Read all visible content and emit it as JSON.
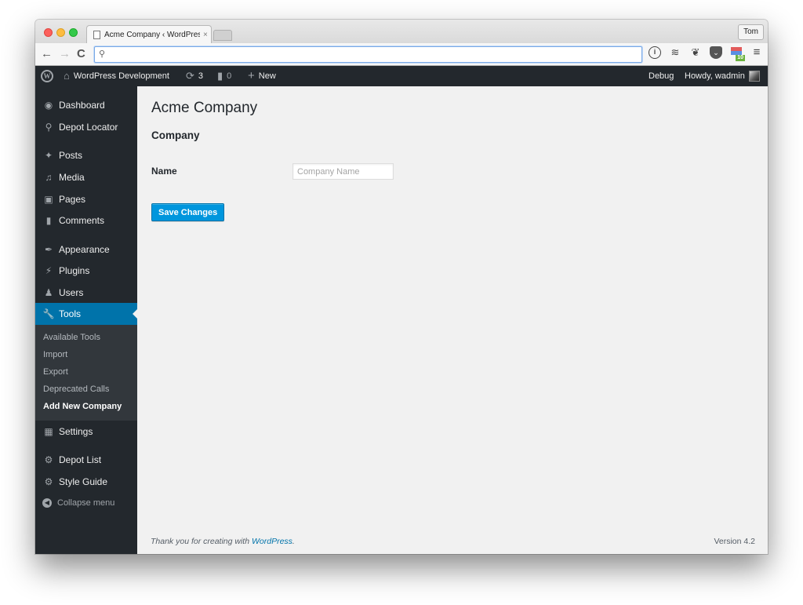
{
  "browser": {
    "tab_title": "Acme Company ‹ WordPress",
    "tab_close": "×",
    "profile_name": "Tom",
    "nav": {
      "back": "←",
      "forward": "→",
      "reload": "C"
    },
    "omnibox_value": "",
    "omnibox_icon": "🔍",
    "extensions": [
      {
        "name": "1password-icon",
        "glyph": "i"
      },
      {
        "name": "buffer-icon",
        "glyph": "≋"
      },
      {
        "name": "evernote-icon",
        "glyph": "❦"
      },
      {
        "name": "pocket-icon",
        "glyph": "⌄"
      },
      {
        "name": "hatena-icon",
        "badge": "10"
      },
      {
        "name": "menu-icon",
        "glyph": "≡"
      }
    ]
  },
  "adminbar": {
    "site_name": "WordPress Development",
    "updates_count": "3",
    "comments_count": "0",
    "new_label": "New",
    "debug_label": "Debug",
    "greeting": "Howdy, wadmin"
  },
  "sidebar": {
    "items": [
      {
        "label": "Dashboard",
        "icon": "dashboard-icon"
      },
      {
        "label": "Depot Locator",
        "icon": "location-icon"
      },
      {
        "label": "Posts",
        "icon": "pin-icon"
      },
      {
        "label": "Media",
        "icon": "media-icon"
      },
      {
        "label": "Pages",
        "icon": "pages-icon"
      },
      {
        "label": "Comments",
        "icon": "comments-icon"
      },
      {
        "label": "Appearance",
        "icon": "brush-icon"
      },
      {
        "label": "Plugins",
        "icon": "plug-icon"
      },
      {
        "label": "Users",
        "icon": "user-icon"
      },
      {
        "label": "Tools",
        "icon": "wrench-icon",
        "current": true
      },
      {
        "label": "Settings",
        "icon": "settings-icon"
      },
      {
        "label": "Depot List",
        "icon": "gear-icon"
      },
      {
        "label": "Style Guide",
        "icon": "gear-icon"
      }
    ],
    "tools_submenu": [
      {
        "label": "Available Tools"
      },
      {
        "label": "Import"
      },
      {
        "label": "Export"
      },
      {
        "label": "Deprecated Calls"
      },
      {
        "label": "Add New Company",
        "current": true
      }
    ],
    "collapse_label": "Collapse menu"
  },
  "main": {
    "page_title": "Acme Company",
    "section_title": "Company",
    "fields": [
      {
        "label": "Name",
        "value": "",
        "placeholder": "Company Name"
      }
    ],
    "save_label": "Save Changes"
  },
  "footer": {
    "thanks_prefix": "Thank you for creating with ",
    "thanks_link": "WordPress",
    "thanks_suffix": ".",
    "version": "Version 4.2"
  },
  "colors": {
    "admin_dark": "#23282d",
    "submenu_bg": "#32373c",
    "accent": "#0073aa",
    "button": "#0096dd",
    "content_bg": "#f1f1f1"
  }
}
